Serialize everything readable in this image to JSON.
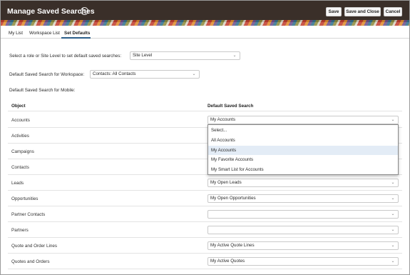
{
  "header": {
    "title": "Manage Saved Searches",
    "help_glyph": "?",
    "save_label": "Save",
    "save_close_label": "Save and Close",
    "cancel_label": "Cancel"
  },
  "tabs": [
    {
      "label": "My List"
    },
    {
      "label": "Workspace List"
    },
    {
      "label": "Set Defaults"
    }
  ],
  "role_prompt": "Select a role or Site Level to set default saved searches:",
  "role_value": "Site Level",
  "workspace_label": "Default Saved Search for Workspace:",
  "workspace_value": "Contacts: All Contacts",
  "mobile_label": "Default Saved Search for Mobile:",
  "table": {
    "col_object": "Object",
    "col_default": "Default Saved Search",
    "rows": [
      {
        "object": "Accounts",
        "value": "My Accounts"
      },
      {
        "object": "Activities",
        "value": ""
      },
      {
        "object": "Campaigns",
        "value": ""
      },
      {
        "object": "Contacts",
        "value": ""
      },
      {
        "object": "Leads",
        "value": "My Open Leads"
      },
      {
        "object": "Opportunities",
        "value": "My Open Opportunities"
      },
      {
        "object": "Partner Contacts",
        "value": ""
      },
      {
        "object": "Partners",
        "value": ""
      },
      {
        "object": "Quote and Order Lines",
        "value": "My Active Quote Lines"
      },
      {
        "object": "Quotes and Orders",
        "value": "My Active Quotes"
      }
    ]
  },
  "dropdown_options": [
    "Select...",
    "All Accounts",
    "My Accounts",
    "My Favorite Accounts",
    "My Smart List for Accounts"
  ],
  "dropdown_highlighted": "My Accounts",
  "icons": {
    "chevron": "chevron-down-icon",
    "help": "help-icon"
  },
  "colors": {
    "header_bg": "#3a2f29",
    "tab_accent": "#2c5f8a",
    "highlight": "#e3ecf6"
  }
}
